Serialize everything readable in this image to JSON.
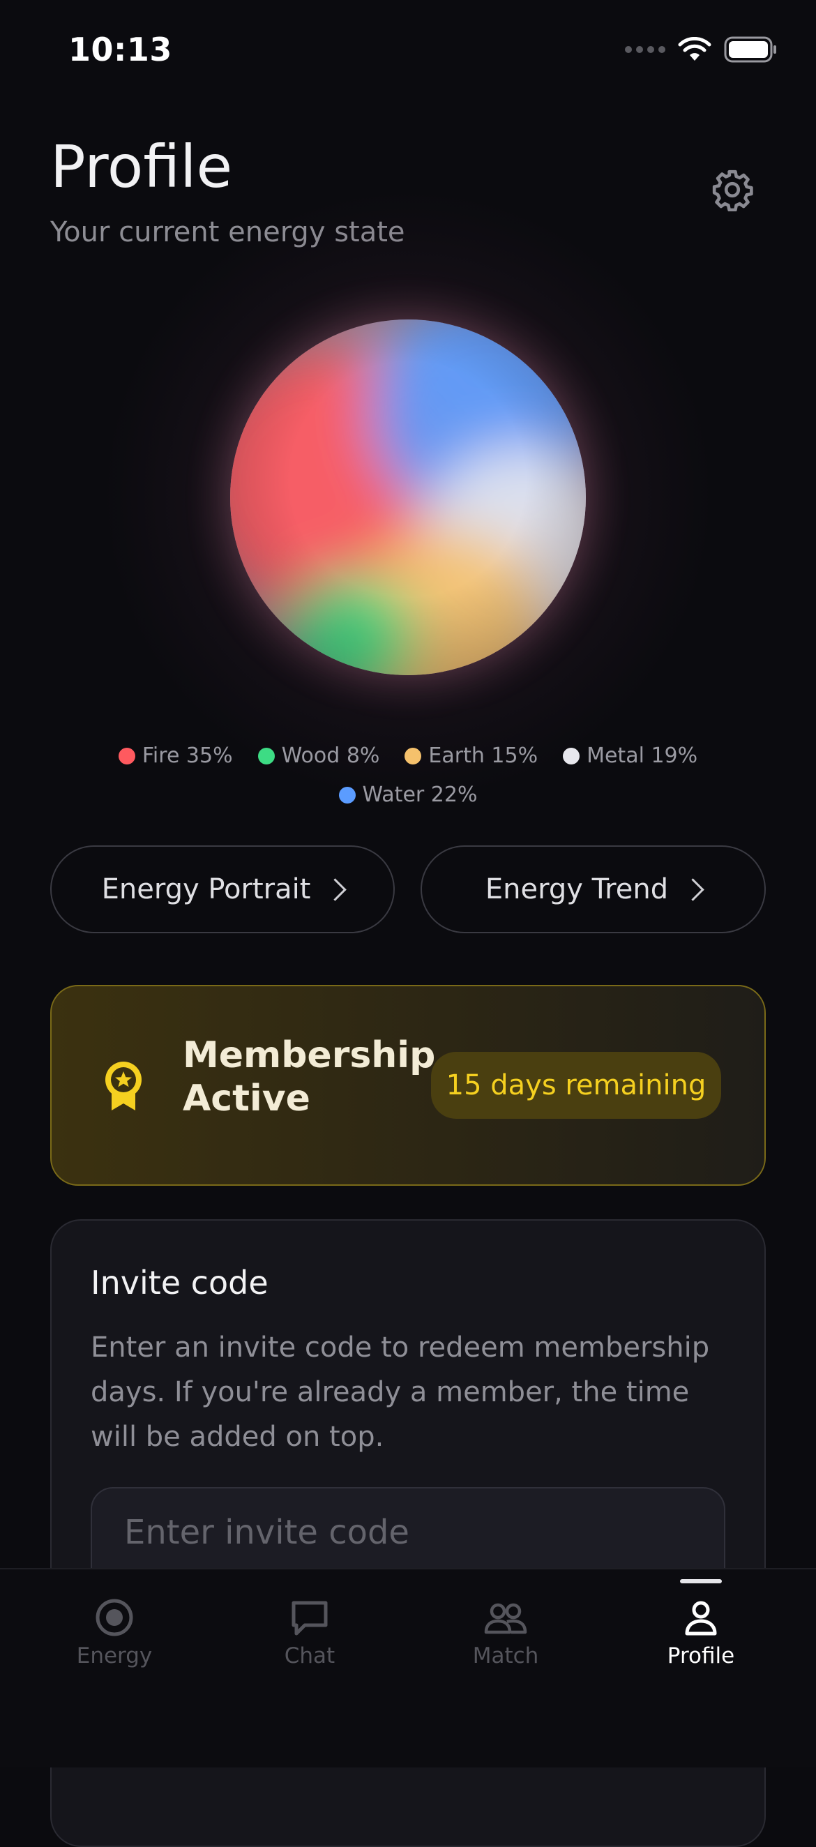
{
  "status_bar": {
    "time": "10:13"
  },
  "header": {
    "title": "Profile",
    "subtitle": "Your current energy state"
  },
  "energy": {
    "elements": [
      {
        "name": "Fire",
        "percent": 35,
        "label": "Fire 35%",
        "color": "#ff5a5f"
      },
      {
        "name": "Wood",
        "percent": 8,
        "label": "Wood 8%",
        "color": "#3ddc84"
      },
      {
        "name": "Earth",
        "percent": 15,
        "label": "Earth 15%",
        "color": "#f5c16c"
      },
      {
        "name": "Metal",
        "percent": 19,
        "label": "Metal 19%",
        "color": "#e8e8ee"
      },
      {
        "name": "Water",
        "percent": 22,
        "label": "Water 22%",
        "color": "#5b9cff"
      }
    ]
  },
  "actions": {
    "portrait_label": "Energy Portrait",
    "trend_label": "Energy Trend"
  },
  "membership": {
    "title_line1": "Membership",
    "title_line2": "Active",
    "badge": "15 days remaining",
    "accent_color": "#f5d020"
  },
  "invite": {
    "title": "Invite code",
    "description": "Enter an invite code to redeem membership days. If you're already a member, the time will be added on top.",
    "placeholder": "Enter invite code",
    "value": ""
  },
  "tab_bar": {
    "tabs": [
      {
        "label": "Energy",
        "icon": "energy-icon",
        "active": false
      },
      {
        "label": "Chat",
        "icon": "chat-icon",
        "active": false
      },
      {
        "label": "Match",
        "icon": "match-icon",
        "active": false
      },
      {
        "label": "Profile",
        "icon": "profile-icon",
        "active": true
      }
    ]
  }
}
